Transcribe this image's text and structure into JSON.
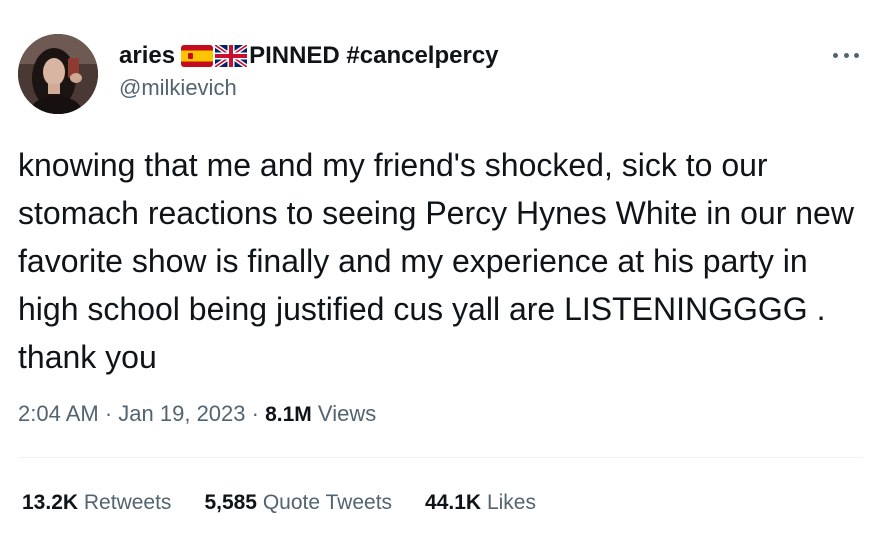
{
  "tweet": {
    "display_name": "aries",
    "name_suffix": "PINNED #cancelpercy",
    "flags": [
      "flag-spain",
      "flag-united-kingdom"
    ],
    "handle": "@milkievich",
    "more_icon": "more-horizontal-icon",
    "text": "knowing that me and my friend's shocked, sick to our stomach reactions to seeing Percy Hynes White in our new favorite show is finally and my experience at his party in high school being justified cus yall are LISTENINGGGG . thank you",
    "time": "2:04 AM",
    "separator": "·",
    "date": "Jan 19, 2023",
    "views_count": "8.1M",
    "views_label": "Views",
    "stats": {
      "retweets_count": "13.2K",
      "retweets_label": "Retweets",
      "quotes_count": "5,585",
      "quotes_label": "Quote Tweets",
      "likes_count": "44.1K",
      "likes_label": "Likes"
    }
  },
  "colors": {
    "text_primary": "#0f1419",
    "text_secondary": "#536471",
    "divider": "#eff3f4",
    "background": "#ffffff"
  }
}
